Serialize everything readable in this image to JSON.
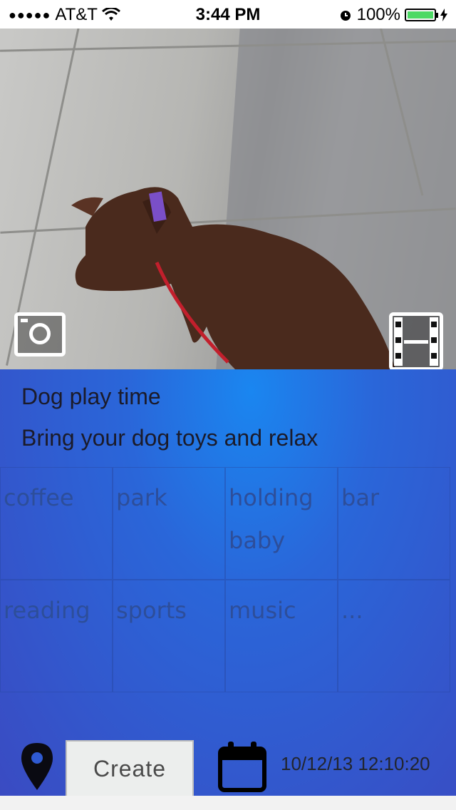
{
  "status_bar": {
    "signal": "●●●●●",
    "carrier": "AT&T",
    "time": "3:44 PM",
    "battery_percent": "100%",
    "icons": [
      "wifi-icon",
      "alarm-icon",
      "battery-icon",
      "charging-icon"
    ]
  },
  "photo": {
    "camera_icon": "camera-icon",
    "video_icon": "film-icon"
  },
  "event": {
    "title": "Dog play time",
    "description": "Bring your dog toys and relax"
  },
  "tags": [
    {
      "label": "coffee"
    },
    {
      "label": "park"
    },
    {
      "label": "holding baby"
    },
    {
      "label": "bar"
    },
    {
      "label": "reading"
    },
    {
      "label": "sports"
    },
    {
      "label": "music"
    },
    {
      "label": "..."
    }
  ],
  "footer": {
    "location_icon": "location-pin-icon",
    "create_label": "Create",
    "calendar_icon": "calendar-icon",
    "datetime": "10/12/13 12:10:20"
  },
  "colors": {
    "form_gradient_start": "#1a86f0",
    "form_gradient_end": "#3a4bc2",
    "battery": "#4cd964"
  }
}
